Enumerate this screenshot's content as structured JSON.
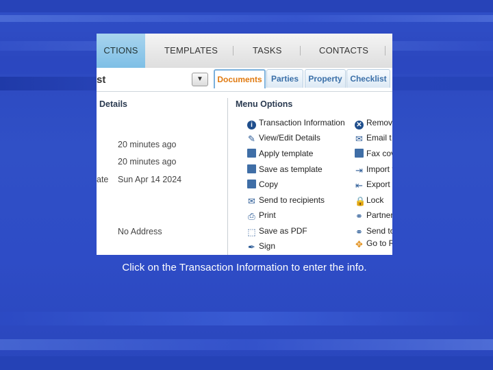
{
  "nav": {
    "items": [
      {
        "label": "CTIONS",
        "active": true
      },
      {
        "label": "TEMPLATES"
      },
      {
        "label": "TASKS"
      },
      {
        "label": "CONTACTS"
      }
    ]
  },
  "transaction": {
    "title_fragment": "st"
  },
  "tabs": [
    "Documents",
    "Parties",
    "Property",
    "Checklist"
  ],
  "details": {
    "heading": "Details",
    "rows": [
      {
        "label": "",
        "value": "20 minutes ago"
      },
      {
        "label": "",
        "value": "20 minutes ago"
      },
      {
        "label": "ate",
        "value": "Sun Apr 14 2024"
      },
      {
        "label": "",
        "value": "No Address"
      }
    ]
  },
  "menu": {
    "heading": "Menu Options",
    "left": [
      {
        "label": "Transaction Information",
        "icon": "info-icon"
      },
      {
        "label": "View/Edit Details",
        "icon": "edit-icon"
      },
      {
        "label": "Apply template",
        "icon": "template-icon"
      },
      {
        "label": "Save as template",
        "icon": "document-icon"
      },
      {
        "label": "Copy",
        "icon": "copy-icon"
      },
      {
        "label": "Send to recipients",
        "icon": "mail-icon"
      },
      {
        "label": "Print",
        "icon": "printer-icon"
      },
      {
        "label": "Save as PDF",
        "icon": "pdf-icon"
      },
      {
        "label": "Sign",
        "icon": "pen-icon"
      }
    ],
    "right": [
      {
        "label": "Remove",
        "icon": "remove-icon"
      },
      {
        "label": "Email t",
        "icon": "mail-icon"
      },
      {
        "label": "Fax cov",
        "icon": "fax-icon"
      },
      {
        "label": "Import f",
        "icon": "import-icon"
      },
      {
        "label": "Export",
        "icon": "export-icon"
      },
      {
        "label": "Lock",
        "icon": "lock-icon"
      },
      {
        "label": "Partner",
        "icon": "handshake-icon"
      },
      {
        "label": "Send to",
        "icon": "handshake-icon"
      },
      {
        "label": "Go to R",
        "icon": "network-icon"
      }
    ]
  },
  "caption": "Click on the Transaction Information to enter the info.",
  "colors": {
    "accent_tab": "#e07a10",
    "nav_active": "#8cc8ea",
    "background": "#2e4cc6"
  }
}
